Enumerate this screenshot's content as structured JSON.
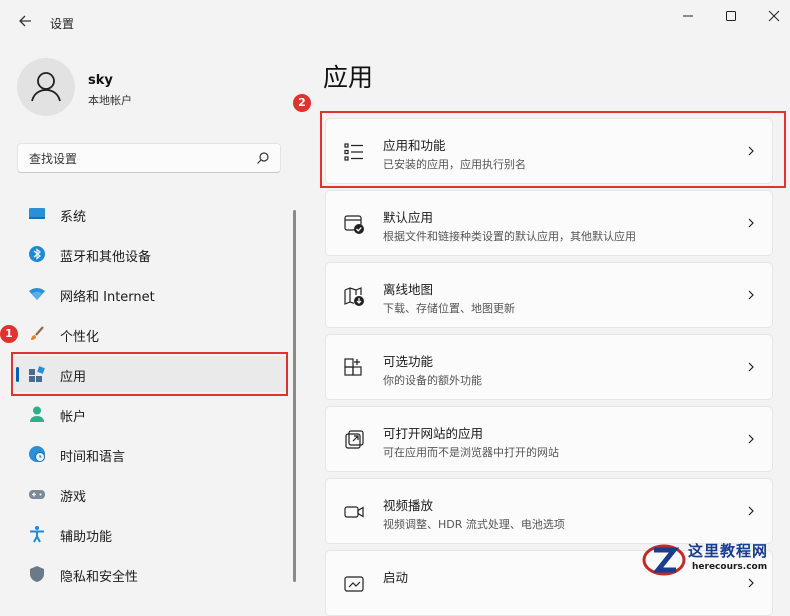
{
  "window": {
    "title": "设置",
    "minimize_icon": "minimize-icon",
    "maximize_icon": "maximize-icon",
    "close_icon": "close-icon"
  },
  "profile": {
    "name": "sky",
    "account_type": "本地帐户"
  },
  "search": {
    "placeholder": "查找设置"
  },
  "sidebar": {
    "items": [
      {
        "label": "系统",
        "icon": "display-icon"
      },
      {
        "label": "蓝牙和其他设备",
        "icon": "bluetooth-icon"
      },
      {
        "label": "网络和 Internet",
        "icon": "wifi-icon"
      },
      {
        "label": "个性化",
        "icon": "brush-icon"
      },
      {
        "label": "应用",
        "icon": "apps-icon",
        "active": true
      },
      {
        "label": "帐户",
        "icon": "account-icon"
      },
      {
        "label": "时间和语言",
        "icon": "globe-clock-icon"
      },
      {
        "label": "游戏",
        "icon": "gamepad-icon"
      },
      {
        "label": "辅助功能",
        "icon": "accessibility-icon"
      },
      {
        "label": "隐私和安全性",
        "icon": "shield-icon"
      }
    ]
  },
  "main": {
    "title": "应用",
    "cards": [
      {
        "title": "应用和功能",
        "subtitle": "已安装的应用，应用执行别名",
        "icon": "list-icon"
      },
      {
        "title": "默认应用",
        "subtitle": "根据文件和链接种类设置的默认应用，其他默认应用",
        "icon": "default-apps-icon"
      },
      {
        "title": "离线地图",
        "subtitle": "下载、存储位置、地图更新",
        "icon": "map-download-icon"
      },
      {
        "title": "可选功能",
        "subtitle": "你的设备的额外功能",
        "icon": "add-grid-icon"
      },
      {
        "title": "可打开网站的应用",
        "subtitle": "可在应用而不是浏览器中打开的网站",
        "icon": "open-link-icon"
      },
      {
        "title": "视频播放",
        "subtitle": "视频调整、HDR 流式处理、电池选项",
        "icon": "video-icon"
      },
      {
        "title": "启动",
        "subtitle": "",
        "icon": "startup-icon"
      }
    ]
  },
  "annotations": {
    "badge1": "1",
    "badge2": "2",
    "color": "#e0322e"
  },
  "watermark": {
    "title": "这里教程网",
    "url": "herecours.com"
  },
  "colors": {
    "accent": "#005fb8",
    "background": "#f3f3f3",
    "card": "#fbfbfb"
  }
}
